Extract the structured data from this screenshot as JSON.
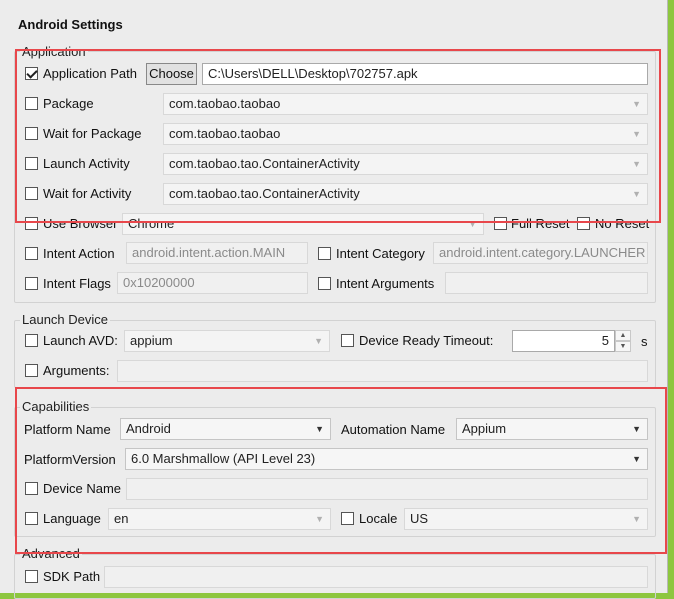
{
  "window_title": "Android Settings",
  "application": {
    "legend": "Application",
    "app_path": {
      "label": "Application Path",
      "checked": true,
      "button": "Choose",
      "value": "C:\\Users\\DELL\\Desktop\\702757.apk"
    },
    "package": {
      "label": "Package",
      "value": "com.taobao.taobao"
    },
    "wait_package": {
      "label": "Wait for Package",
      "value": "com.taobao.taobao"
    },
    "launch_activity": {
      "label": "Launch Activity",
      "value": "com.taobao.tao.ContainerActivity"
    },
    "wait_activity": {
      "label": "Wait for Activity",
      "value": "com.taobao.tao.ContainerActivity"
    },
    "use_browser": {
      "label": "Use Browser",
      "value": "Chrome"
    },
    "full_reset": {
      "label": "Full Reset"
    },
    "no_reset": {
      "label": "No Reset"
    },
    "intent_action": {
      "label": "Intent Action",
      "value": "android.intent.action.MAIN"
    },
    "intent_category": {
      "label": "Intent Category",
      "value": "android.intent.category.LAUNCHER"
    },
    "intent_flags": {
      "label": "Intent Flags",
      "value": "0x10200000"
    },
    "intent_arguments": {
      "label": "Intent Arguments",
      "value": ""
    }
  },
  "launch_device": {
    "legend": "Launch Device",
    "launch_avd": {
      "label": "Launch AVD:",
      "value": "appium"
    },
    "device_ready": {
      "label": "Device Ready Timeout:",
      "value": "5",
      "unit": "s"
    },
    "arguments": {
      "label": "Arguments:",
      "value": ""
    }
  },
  "capabilities": {
    "legend": "Capabilities",
    "platform_name": {
      "label": "Platform Name",
      "value": "Android"
    },
    "automation_name": {
      "label": "Automation Name",
      "value": "Appium"
    },
    "platform_version": {
      "label": "PlatformVersion",
      "value": "6.0 Marshmallow (API Level 23)"
    },
    "device_name": {
      "label": "Device Name",
      "value": ""
    },
    "language": {
      "label": "Language",
      "value": "en"
    },
    "locale": {
      "label": "Locale",
      "value": "US"
    }
  },
  "advanced": {
    "legend": "Advanced",
    "sdk_path": {
      "label": "SDK Path",
      "value": ""
    }
  },
  "colors": {
    "highlight": "#e8474b",
    "frame": "#8dc63f"
  }
}
